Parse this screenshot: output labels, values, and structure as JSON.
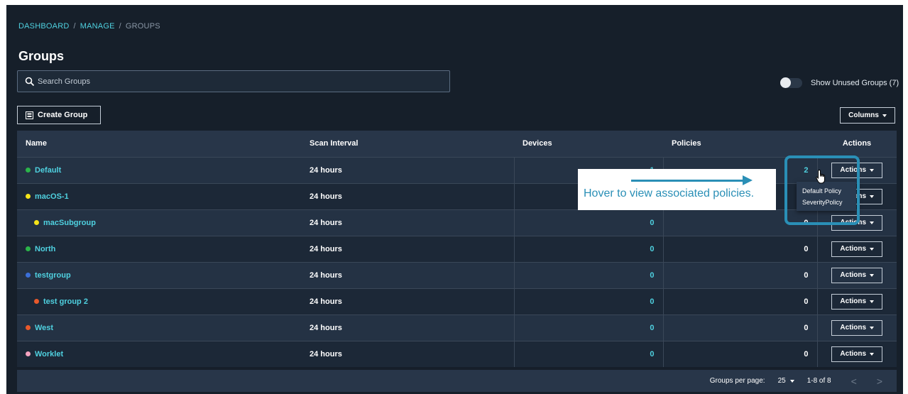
{
  "breadcrumb": {
    "items": [
      "DASHBOARD",
      "MANAGE"
    ],
    "separator": "/",
    "current": "GROUPS"
  },
  "title": "Groups",
  "search": {
    "placeholder": "Search Groups",
    "value": ""
  },
  "toggle": {
    "label": "Show Unused Groups (7)",
    "checked": false
  },
  "buttons": {
    "create_group": "Create Group",
    "columns": "Columns"
  },
  "table": {
    "columns": [
      "Name",
      "Scan Interval",
      "Devices",
      "Policies",
      "Actions"
    ],
    "rows": [
      {
        "name": "Default",
        "color": "#2bb44a",
        "indent": false,
        "scan_interval": "24 hours",
        "devices": "1",
        "policies": "2",
        "action": "Actions"
      },
      {
        "name": "macOS-1",
        "color": "#f5e419",
        "indent": false,
        "scan_interval": "24 hours",
        "devices": "",
        "policies": "",
        "action": "Actions"
      },
      {
        "name": "macSubgroup",
        "color": "#f5e419",
        "indent": true,
        "scan_interval": "24 hours",
        "devices": "0",
        "policies": "0",
        "action": "Actions"
      },
      {
        "name": "North",
        "color": "#2bb44a",
        "indent": false,
        "scan_interval": "24 hours",
        "devices": "0",
        "policies": "0",
        "action": "Actions"
      },
      {
        "name": "testgroup",
        "color": "#3b6fd8",
        "indent": false,
        "scan_interval": "24 hours",
        "devices": "0",
        "policies": "0",
        "action": "Actions"
      },
      {
        "name": "test group 2",
        "color": "#e8592b",
        "indent": true,
        "scan_interval": "24 hours",
        "devices": "0",
        "policies": "0",
        "action": "Actions"
      },
      {
        "name": "West",
        "color": "#e8592b",
        "indent": false,
        "scan_interval": "24 hours",
        "devices": "0",
        "policies": "0",
        "action": "Actions"
      },
      {
        "name": "Worklet",
        "color": "#f4a3c0",
        "indent": false,
        "scan_interval": "24 hours",
        "devices": "0",
        "policies": "0",
        "action": "Actions"
      }
    ]
  },
  "pagination": {
    "label": "Groups per page:",
    "per_page": "25",
    "range": "1-8 of 8",
    "prev": "<",
    "next": ">"
  },
  "callout": {
    "text": "Hover to view associated policies."
  },
  "tooltip": {
    "items": [
      "Default Policy",
      "SeverityPolicy"
    ]
  },
  "colors": {
    "background": "#161f2a",
    "accent": "#4fd1e0",
    "header": "#283649",
    "callout_blue": "#2a8fb6"
  }
}
